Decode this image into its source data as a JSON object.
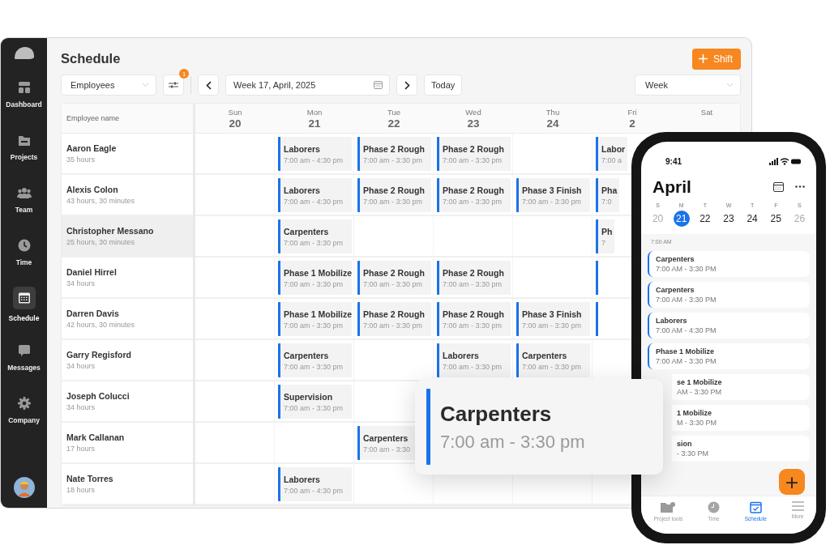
{
  "sidebar": {
    "items": [
      {
        "label": "Dashboard",
        "selected": false
      },
      {
        "label": "Projects",
        "selected": false
      },
      {
        "label": "Team",
        "selected": false
      },
      {
        "label": "Time",
        "selected": false
      },
      {
        "label": "Schedule",
        "selected": true
      },
      {
        "label": "Messages",
        "selected": false
      },
      {
        "label": "Company",
        "selected": false
      }
    ]
  },
  "header": {
    "title": "Schedule",
    "add_button": "Shift"
  },
  "toolbar": {
    "group_select": "Employees",
    "filter_badge": "1",
    "week_field": "Week 17, April, 2025",
    "today_button": "Today",
    "view_select": "Week"
  },
  "grid": {
    "name_column": "Employee name",
    "days": [
      {
        "name": "Sun",
        "date": "20"
      },
      {
        "name": "Mon",
        "date": "21"
      },
      {
        "name": "Tue",
        "date": "22"
      },
      {
        "name": "Wed",
        "date": "23"
      },
      {
        "name": "Thu",
        "date": "24"
      },
      {
        "name": "Fri",
        "date": "2"
      },
      {
        "name": "Sat"
      }
    ],
    "rows": [
      {
        "name": "Aaron Eagle",
        "hours": "35 hours",
        "selected": false,
        "cells": [
          {
            "kind": "empty"
          },
          {
            "kind": "shift",
            "title": "Laborers",
            "time": "7:00 am - 4:30 pm"
          },
          {
            "kind": "shift",
            "title": "Phase 2 Rough",
            "time": "7:00 am - 3:30 pm"
          },
          {
            "kind": "shift",
            "title": "Phase 2 Rough",
            "time": "7:00 am - 3:30 pm"
          },
          {
            "kind": "empty"
          },
          {
            "kind": "partial",
            "title": "Labor",
            "time": "7:00 a"
          }
        ]
      },
      {
        "name": "Alexis Colon",
        "hours": "43 hours, 30 minutes",
        "selected": false,
        "cells": [
          {
            "kind": "empty"
          },
          {
            "kind": "shift",
            "title": "Laborers",
            "time": "7:00 am - 4:30 pm"
          },
          {
            "kind": "shift",
            "title": "Phase 2 Rough",
            "time": "7:00 am - 3:30 pm"
          },
          {
            "kind": "shift",
            "title": "Phase 2 Rough",
            "time": "7:00 am - 3:30 pm"
          },
          {
            "kind": "shift",
            "title": "Phase 3 Finish",
            "time": "7:00 am - 3:30 pm"
          },
          {
            "kind": "partial",
            "title": "Pha",
            "time": "7:0"
          }
        ]
      },
      {
        "name": "Christopher Messano",
        "hours": "25 hours, 30 minutes",
        "selected": true,
        "cells": [
          {
            "kind": "empty"
          },
          {
            "kind": "shift",
            "title": "Carpenters",
            "time": "7:00 am - 3:30 pm"
          },
          {
            "kind": "empty"
          },
          {
            "kind": "empty"
          },
          {
            "kind": "empty"
          },
          {
            "kind": "partial",
            "title": "Ph",
            "time": "7"
          }
        ]
      },
      {
        "name": "Daniel Hirrel",
        "hours": "34 hours",
        "selected": false,
        "cells": [
          {
            "kind": "empty"
          },
          {
            "kind": "shift",
            "title": "Phase 1 Mobilize",
            "time": "7:00 am - 3:30 pm"
          },
          {
            "kind": "shift",
            "title": "Phase 2 Rough",
            "time": "7:00 am - 3:30 pm"
          },
          {
            "kind": "shift",
            "title": "Phase 2 Rough",
            "time": "7:00 am - 3:30 pm"
          },
          {
            "kind": "empty"
          },
          {
            "kind": "bar"
          }
        ]
      },
      {
        "name": "Darren Davis",
        "hours": "42 hours, 30 minutes",
        "selected": false,
        "cells": [
          {
            "kind": "empty"
          },
          {
            "kind": "shift",
            "title": "Phase 1 Mobilize",
            "time": "7:00 am - 3:30 pm"
          },
          {
            "kind": "shift",
            "title": "Phase 2 Rough",
            "time": "7:00 am - 3:30 pm"
          },
          {
            "kind": "shift",
            "title": "Phase 2 Rough",
            "time": "7:00 am - 3:30 pm"
          },
          {
            "kind": "shift",
            "title": "Phase 3 Finish",
            "time": "7:00 am - 3:30 pm"
          },
          {
            "kind": "bar"
          }
        ]
      },
      {
        "name": "Garry Regisford",
        "hours": "34 hours",
        "selected": false,
        "cells": [
          {
            "kind": "empty"
          },
          {
            "kind": "shift",
            "title": "Carpenters",
            "time": "7:00 am - 3:30 pm"
          },
          {
            "kind": "empty"
          },
          {
            "kind": "shift",
            "title": "Laborers",
            "time": "7:00 am - 3:30 pm"
          },
          {
            "kind": "shift",
            "title": "Carpenters",
            "time": "7:00 am - 3:30 pm"
          },
          {
            "kind": "empty"
          }
        ]
      },
      {
        "name": "Joseph Colucci",
        "hours": "34 hours",
        "selected": false,
        "cells": [
          {
            "kind": "empty"
          },
          {
            "kind": "shift",
            "title": "Supervision",
            "time": "7:00 am - 3:30 pm"
          },
          {
            "kind": "empty"
          },
          {
            "kind": "empty"
          },
          {
            "kind": "empty"
          },
          {
            "kind": "empty"
          }
        ]
      },
      {
        "name": "Mark Callanan",
        "hours": "17 hours",
        "selected": false,
        "cells": [
          {
            "kind": "empty"
          },
          {
            "kind": "empty"
          },
          {
            "kind": "shift",
            "title": "Carpenters",
            "time": "7:00 am - 3:30"
          },
          {
            "kind": "empty"
          },
          {
            "kind": "empty"
          },
          {
            "kind": "empty"
          }
        ]
      },
      {
        "name": "Nate Torres",
        "hours": "18 hours",
        "selected": false,
        "cells": [
          {
            "kind": "empty"
          },
          {
            "kind": "shift",
            "title": "Laborers",
            "time": "7:00 am - 4:30 pm"
          },
          {
            "kind": "empty"
          },
          {
            "kind": "empty"
          },
          {
            "kind": "empty"
          },
          {
            "kind": "empty"
          }
        ]
      }
    ]
  },
  "popup": {
    "title": "Carpenters",
    "time": "7:00 am - 3:30 pm"
  },
  "phone": {
    "clock": "9:41",
    "month": "April",
    "week": [
      {
        "letter": "S",
        "date": "20",
        "selected": false,
        "muted": true
      },
      {
        "letter": "M",
        "date": "21",
        "selected": true,
        "muted": false
      },
      {
        "letter": "T",
        "date": "22",
        "selected": false,
        "muted": false
      },
      {
        "letter": "W",
        "date": "23",
        "selected": false,
        "muted": false
      },
      {
        "letter": "T",
        "date": "24",
        "selected": false,
        "muted": false
      },
      {
        "letter": "F",
        "date": "25",
        "selected": false,
        "muted": false
      },
      {
        "letter": "S",
        "date": "26",
        "selected": false,
        "muted": true
      }
    ],
    "time_label": "7:00 AM",
    "shifts": [
      {
        "kind": "full",
        "title": "Carpenters",
        "time": "7:00 AM - 3:30 PM"
      },
      {
        "kind": "full",
        "title": "Carpenters",
        "time": "7:00 AM - 3:30 PM"
      },
      {
        "kind": "full",
        "title": "Laborers",
        "time": "7:00 AM - 4:30 PM"
      },
      {
        "kind": "full",
        "title": "Phase 1 Mobilize",
        "time": "7:00 AM - 3:30 PM"
      },
      {
        "kind": "clipped",
        "title": "se 1 Mobilize",
        "time": "AM - 3:30 PM"
      },
      {
        "kind": "clipped",
        "title": "1 Mobilize",
        "time": "M - 3:30 PM"
      },
      {
        "kind": "clipped",
        "title": "sion",
        "time": "- 3:30 PM"
      }
    ],
    "fab": "+",
    "tabs": [
      {
        "label": "Project tools",
        "selected": false
      },
      {
        "label": "Time",
        "selected": false
      },
      {
        "label": "Schedule",
        "selected": true
      },
      {
        "label": "More",
        "selected": false
      }
    ]
  }
}
